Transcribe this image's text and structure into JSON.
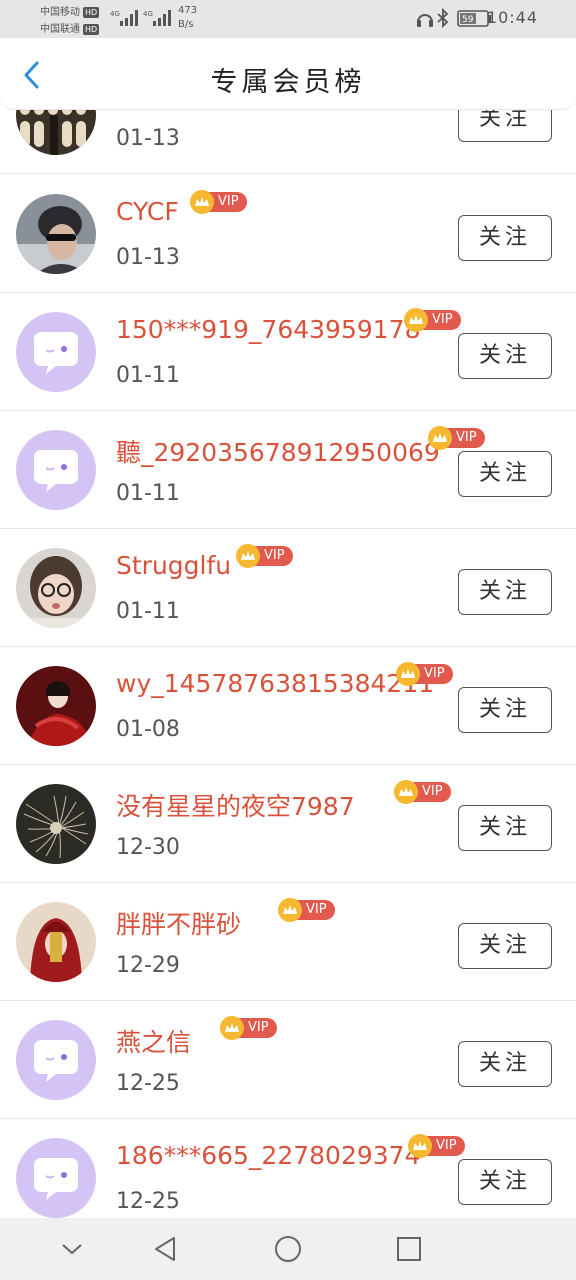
{
  "status_bar": {
    "carrier1": "中国移动",
    "carrier2": "中国联通",
    "hd": "HD",
    "network": "4G",
    "speed_value": "473",
    "speed_unit": "B/s",
    "battery": "59",
    "time": "10:44"
  },
  "header": {
    "title": "专属会员榜",
    "back_icon": "chevron-left-icon"
  },
  "vip_label": "VIP",
  "follow_label": "关注",
  "members": [
    {
      "name": "",
      "date": "01-13",
      "avatar": "photo"
    },
    {
      "name": "CYCF",
      "date": "01-13",
      "avatar": "photo"
    },
    {
      "name": "150***919_7643959178",
      "date": "01-11",
      "avatar": "default"
    },
    {
      "name": "聽_2920356789129500​69",
      "date": "01-11",
      "avatar": "default"
    },
    {
      "name": "Strugglfu",
      "date": "01-11",
      "avatar": "photo"
    },
    {
      "name": "wy_1457876381538​4211",
      "date": "01-08",
      "avatar": "photo"
    },
    {
      "name": "没有星星的夜空7987",
      "date": "12-30",
      "avatar": "photo"
    },
    {
      "name": "胖胖不胖砂",
      "date": "12-29",
      "avatar": "photo"
    },
    {
      "name": "燕之信",
      "date": "12-25",
      "avatar": "default"
    },
    {
      "name": "186***665_2278029374",
      "date": "12-25",
      "avatar": "default"
    }
  ],
  "colors": {
    "accent": "#2a8fe0",
    "name": "#d9533c",
    "vip_tag": "#e25a4e",
    "crown": "#f5b82e",
    "default_avatar": "#d4c3f5"
  }
}
